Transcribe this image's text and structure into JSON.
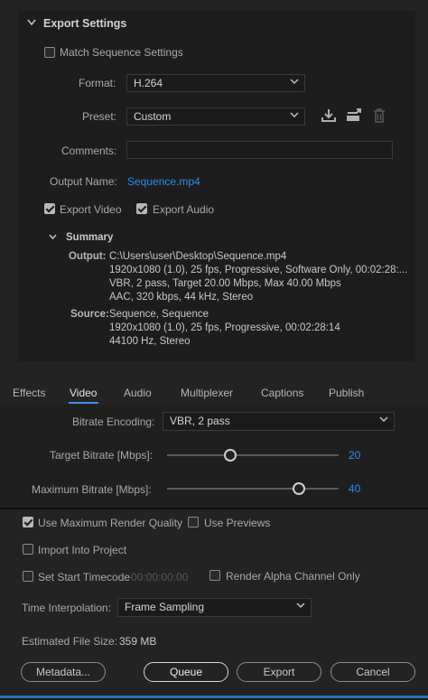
{
  "export_settings": {
    "title": "Export Settings",
    "match_sequence": {
      "label": "Match Sequence Settings",
      "checked": false
    },
    "format": {
      "label": "Format:",
      "value": "H.264"
    },
    "preset": {
      "label": "Preset:",
      "value": "Custom"
    },
    "comments": {
      "label": "Comments:",
      "value": ""
    },
    "output_name": {
      "label": "Output Name:",
      "value": "Sequence.mp4"
    },
    "export_video": {
      "label": "Export Video",
      "checked": true
    },
    "export_audio": {
      "label": "Export Audio",
      "checked": true
    },
    "summary": {
      "title": "Summary",
      "output_label": "Output:",
      "output_lines": [
        "C:\\Users\\user\\Desktop\\Sequence.mp4",
        "1920x1080 (1.0), 25 fps, Progressive, Software Only, 00:02:28:...",
        "VBR, 2 pass, Target 20.00 Mbps, Max 40.00 Mbps",
        "AAC, 320 kbps, 44 kHz, Stereo"
      ],
      "source_label": "Source:",
      "source_lines": [
        "Sequence, Sequence",
        "1920x1080 (1.0), 25 fps, Progressive, 00:02:28:14",
        "44100 Hz, Stereo"
      ]
    }
  },
  "tabs": [
    "Effects",
    "Video",
    "Audio",
    "Multiplexer",
    "Captions",
    "Publish"
  ],
  "active_tab": "Video",
  "video": {
    "bitrate_encoding": {
      "label": "Bitrate Encoding:",
      "value": "VBR, 2 pass"
    },
    "target_bitrate": {
      "label": "Target Bitrate [Mbps]:",
      "value": "20",
      "fraction": 0.37
    },
    "max_bitrate": {
      "label": "Maximum Bitrate [Mbps]:",
      "value": "40",
      "fraction": 0.77
    }
  },
  "options": {
    "use_max_render_quality": {
      "label": "Use Maximum Render Quality",
      "checked": true
    },
    "use_previews": {
      "label": "Use Previews",
      "checked": false
    },
    "import_into_project": {
      "label": "Import Into Project",
      "checked": false
    },
    "set_start_timecode": {
      "label": "Set Start Timecode",
      "checked": false,
      "value": "00:00:00:00"
    },
    "render_alpha": {
      "label": "Render Alpha Channel Only",
      "checked": false
    },
    "time_interpolation": {
      "label": "Time Interpolation:",
      "value": "Frame Sampling"
    },
    "estimated_size": {
      "label": "Estimated File Size:",
      "value": "359 MB"
    }
  },
  "buttons": {
    "metadata": "Metadata...",
    "queue": "Queue",
    "export": "Export",
    "cancel": "Cancel"
  },
  "colors": {
    "accent": "#2d8ceb",
    "background": "#232323",
    "panel": "#1d1d1d"
  },
  "icons": [
    "save-preset-icon",
    "import-preset-icon",
    "delete-preset-icon",
    "chevron-down-icon"
  ]
}
